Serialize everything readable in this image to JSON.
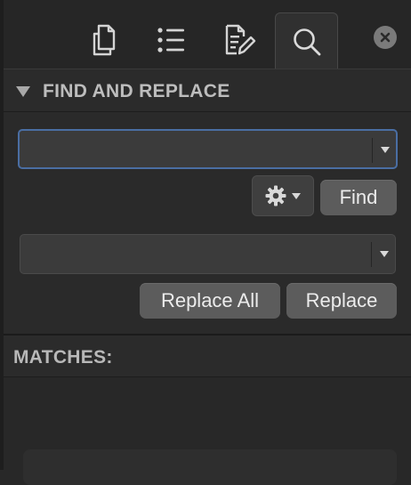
{
  "toolbar": {
    "tabs": [
      {
        "name": "files",
        "icon": "documents-icon"
      },
      {
        "name": "outline",
        "icon": "list-icon"
      },
      {
        "name": "notes",
        "icon": "edit-document-icon"
      },
      {
        "name": "search",
        "icon": "search-icon",
        "active": true
      }
    ],
    "close_icon": "close-icon"
  },
  "find_replace": {
    "title": "FIND AND REPLACE",
    "find_field": {
      "value": "",
      "placeholder": ""
    },
    "replace_field": {
      "value": "",
      "placeholder": ""
    },
    "options_icon": "gear-icon",
    "find_label": "Find",
    "replace_all_label": "Replace All",
    "replace_label": "Replace"
  },
  "matches": {
    "title": "MATCHES:"
  },
  "colors": {
    "background": "#282828",
    "focus_ring": "#4a6ea3",
    "button": "#5c5c5c"
  }
}
